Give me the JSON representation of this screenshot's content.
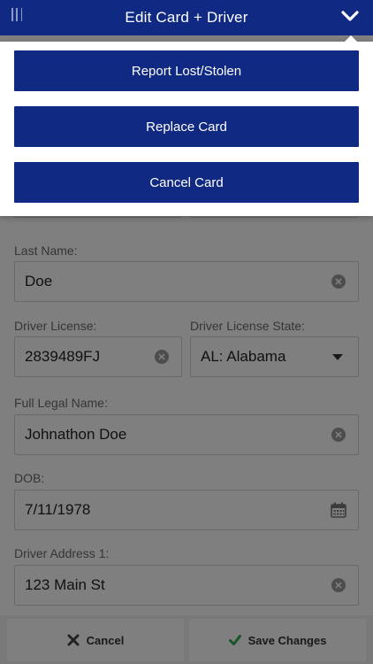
{
  "header": {
    "title": "Edit Card + Driver",
    "menu_icon": "menu-icon",
    "toggle_icon": "chevron-down-icon",
    "bg_color": "#102a83"
  },
  "dropdown": {
    "items": [
      {
        "label": "Report Lost/Stolen"
      },
      {
        "label": "Replace Card"
      },
      {
        "label": "Cancel Card"
      }
    ]
  },
  "form": {
    "last_name": {
      "label": "Last Name:",
      "value": "Doe"
    },
    "driver_license": {
      "label": "Driver License:",
      "value": "2839489FJ"
    },
    "driver_license_state": {
      "label": "Driver License State:",
      "value": "AL: Alabama"
    },
    "full_legal_name": {
      "label": "Full Legal Name:",
      "value": "Johnathon Doe"
    },
    "dob": {
      "label": "DOB:",
      "value": "7/11/1978"
    },
    "driver_address_1": {
      "label": "Driver Address 1:",
      "value": "123 Main St"
    }
  },
  "footer": {
    "cancel_label": "Cancel",
    "save_label": "Save Changes",
    "save_icon_color": "#2eaa55"
  }
}
